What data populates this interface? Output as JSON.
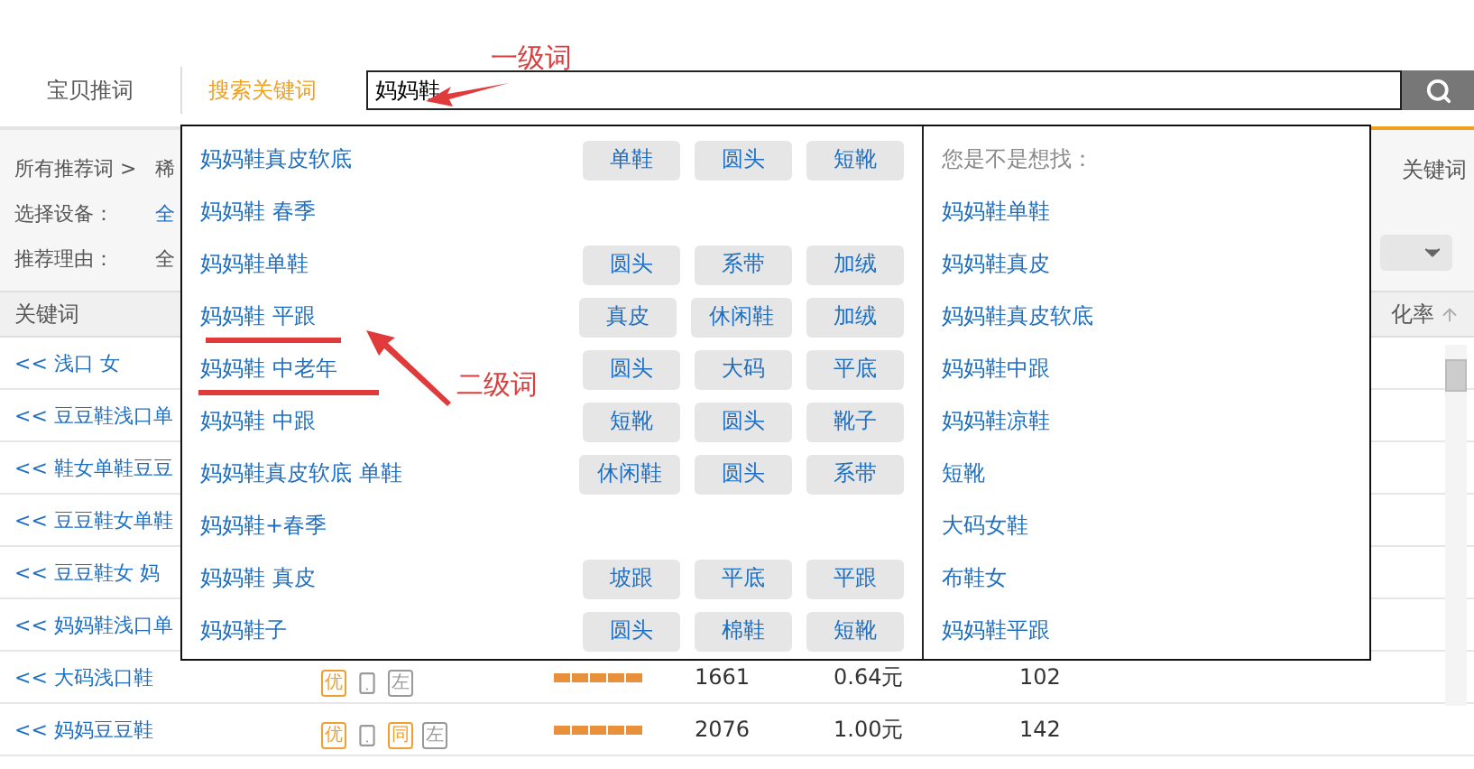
{
  "tabs": [
    {
      "label": "宝贝推词",
      "selected": false
    },
    {
      "label": "搜索关键词",
      "selected": true
    }
  ],
  "search": {
    "value": "妈妈鞋"
  },
  "header_right": "关键词",
  "filters": [
    {
      "label": "所有推荐词 >",
      "value": "稀"
    },
    {
      "label": "选择设备：",
      "value": "全"
    },
    {
      "label": "推荐理由：",
      "value": "全"
    }
  ],
  "table": {
    "columns": [
      {
        "label": "关键词"
      },
      {
        "label": "化率",
        "sortable": true
      }
    ],
    "rows": [
      {
        "keyword": "<< 浅口 女"
      },
      {
        "keyword": "<< 豆豆鞋浅口单"
      },
      {
        "keyword": "<< 鞋女单鞋豆豆"
      },
      {
        "keyword": "<< 豆豆鞋女单鞋"
      },
      {
        "keyword": "<< 豆豆鞋女 妈"
      },
      {
        "keyword": "<< 妈妈鞋浅口单"
      },
      {
        "keyword": "<< 大码浅口鞋",
        "badges": [
          {
            "kind": "tag",
            "label": "优",
            "color": "#f0a030"
          },
          {
            "kind": "phone"
          },
          {
            "kind": "tag",
            "label": "左",
            "color": "#999999"
          }
        ],
        "level": 1,
        "cells": [
          "1661",
          "0.64元",
          "102"
        ]
      },
      {
        "keyword": "<< 妈妈豆豆鞋",
        "badges": [
          {
            "kind": "tag",
            "label": "优",
            "color": "#f0a030"
          },
          {
            "kind": "phone"
          },
          {
            "kind": "tag",
            "label": "同",
            "color": "#f0a030"
          },
          {
            "kind": "tag",
            "label": "左",
            "color": "#999999"
          }
        ],
        "level": 1,
        "cells": [
          "2076",
          "1.00元",
          "142"
        ]
      }
    ]
  },
  "popup": {
    "suggestions": [
      {
        "term": "妈妈鞋真皮软底",
        "underlined": false,
        "tags": [
          "单鞋",
          "圆头",
          "短靴"
        ]
      },
      {
        "term": "妈妈鞋 春季",
        "underlined": false
      },
      {
        "term": "妈妈鞋单鞋",
        "underlined": false,
        "tags": [
          "圆头",
          "系带",
          "加绒"
        ]
      },
      {
        "term": "妈妈鞋 平跟",
        "underlined": true,
        "tags": [
          "真皮",
          "休闲鞋",
          "加绒"
        ]
      },
      {
        "term": "妈妈鞋 中老年",
        "underlined": true,
        "tags": [
          "圆头",
          "大码",
          "平底"
        ]
      },
      {
        "term": "妈妈鞋 中跟",
        "underlined": false,
        "tags": [
          "短靴",
          "圆头",
          "靴子"
        ]
      },
      {
        "term": "妈妈鞋真皮软底 单鞋",
        "underlined": false,
        "tags": [
          "休闲鞋",
          "圆头",
          "系带"
        ]
      },
      {
        "term": "妈妈鞋+春季",
        "underlined": false
      },
      {
        "term": "妈妈鞋 真皮",
        "underlined": false,
        "tags": [
          "坡跟",
          "平底",
          "平跟"
        ]
      },
      {
        "term": "妈妈鞋子",
        "underlined": false,
        "tags": [
          "圆头",
          "棉鞋",
          "短靴"
        ]
      }
    ],
    "related_title": "您是不是想找：",
    "related": [
      "妈妈鞋单鞋",
      "妈妈鞋真皮",
      "妈妈鞋真皮软底",
      "妈妈鞋中跟",
      "妈妈鞋凉鞋",
      "短靴",
      "大码女鞋",
      "布鞋女",
      "妈妈鞋平跟"
    ]
  },
  "annotations": [
    {
      "kind": "level-one",
      "text": "一级词"
    },
    {
      "kind": "level-two",
      "text": "二级词"
    }
  ]
}
